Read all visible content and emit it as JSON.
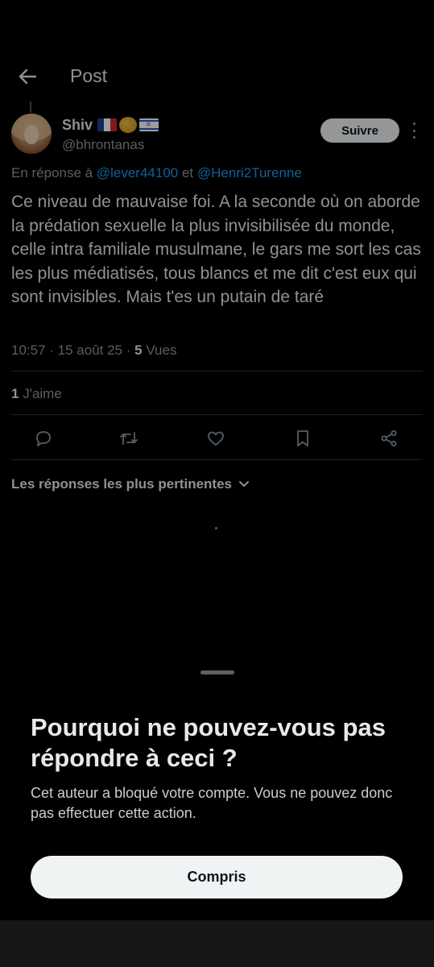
{
  "header": {
    "title": "Post"
  },
  "tweet": {
    "author_name": "Shiv",
    "flags": [
      "flag-france",
      "sun-emoji",
      "flag-israel"
    ],
    "handle": "@bhrontanas",
    "follow_label": "Suivre",
    "reply_prefix": "En réponse à ",
    "reply_mention_1": "@lever44100",
    "reply_conjunction": " et ",
    "reply_mention_2": "@Henri2Turenne",
    "text": "Ce niveau de mauvaise foi. A la seconde où on aborde la prédation sexuelle la plus invisibilisée du monde, celle intra familiale musulmane, le gars me sort les cas les plus médiatisés, tous blancs et me dit c'est eux qui sont invisibles. Mais t'es un putain de taré",
    "time": "10:57",
    "date": "15 août 25",
    "views_count": "5",
    "views_label": "Vues",
    "likes_count": "1",
    "likes_label": "J'aime",
    "actions": [
      "reply-icon",
      "retweet-icon",
      "like-icon",
      "bookmark-icon",
      "share-icon"
    ]
  },
  "replies": {
    "sort_label": "Les réponses les plus pertinentes"
  },
  "sheet": {
    "title": "Pourquoi ne pouvez-vous pas répondre à ceci ?",
    "body": "Cet auteur a bloqué votre compte. Vous ne pouvez donc pas effectuer cette action.",
    "button_label": "Compris"
  },
  "colors": {
    "background": "#000000",
    "accent": "#1d9bf0",
    "muted": "#8b98a5",
    "button": "#eff3f4"
  }
}
